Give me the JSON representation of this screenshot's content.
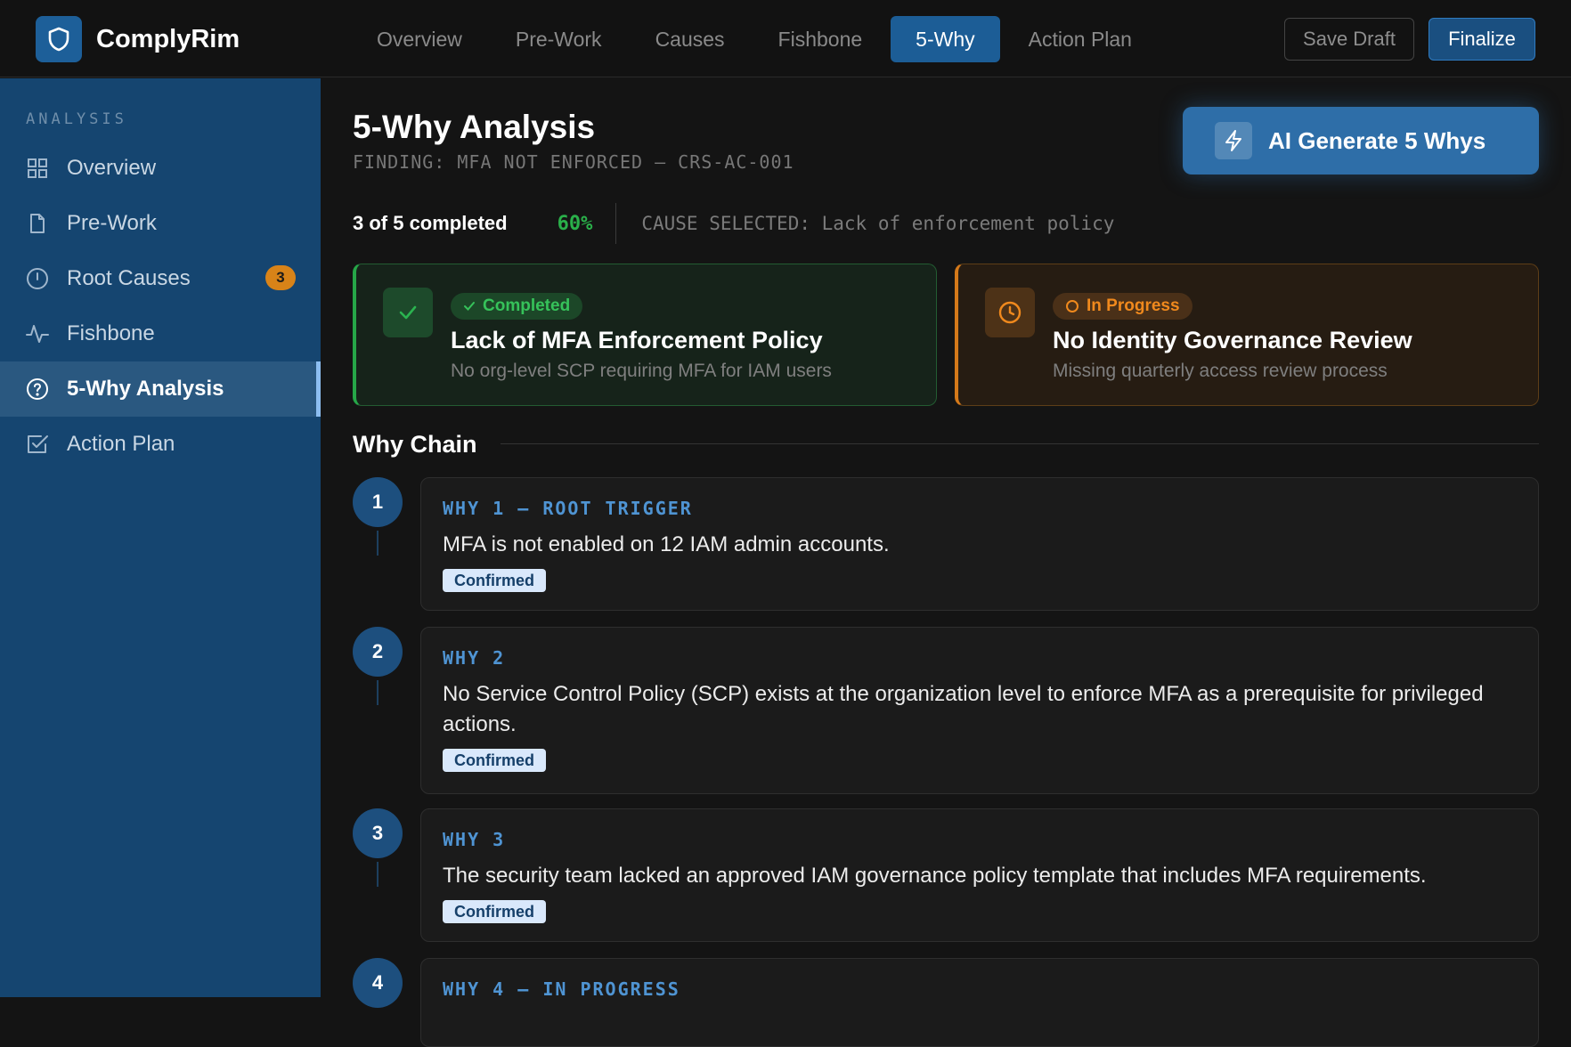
{
  "app": {
    "name": "ComplyRim"
  },
  "topnav": {
    "tabs": [
      {
        "label": "Overview"
      },
      {
        "label": "Pre-Work"
      },
      {
        "label": "Causes"
      },
      {
        "label": "Fishbone"
      },
      {
        "label": "5-Why",
        "active": true
      },
      {
        "label": "Action Plan"
      }
    ],
    "save_label": "Save Draft",
    "finalize_label": "Finalize"
  },
  "sidebar": {
    "section": "ANALYSIS",
    "items": [
      {
        "label": "Overview",
        "icon": "grid-icon"
      },
      {
        "label": "Pre-Work",
        "icon": "document-icon"
      },
      {
        "label": "Root Causes",
        "icon": "alert-circle-icon",
        "badge": "3"
      },
      {
        "label": "Fishbone",
        "icon": "pulse-icon"
      },
      {
        "label": "5-Why Analysis",
        "icon": "help-circle-icon",
        "active": true
      },
      {
        "label": "Action Plan",
        "icon": "checkbox-icon"
      }
    ]
  },
  "main": {
    "title": "5-Why Analysis",
    "finding": "FINDING: MFA NOT ENFORCED — CRS-AC-001",
    "ai_button": "AI Generate 5 Whys",
    "progress": {
      "text": "3 of 5 completed",
      "percent": "60%",
      "cause_selected": "CAUSE SELECTED: Lack of enforcement policy"
    },
    "causes": [
      {
        "status": "Completed",
        "title": "Lack of MFA Enforcement Policy",
        "desc": "No org-level SCP requiring MFA for IAM users",
        "color": "#26a748"
      },
      {
        "status": "In Progress",
        "title": "No Identity Governance Review",
        "desc": "Missing quarterly access review process",
        "color": "#d4791a"
      }
    ],
    "section_title": "Why Chain",
    "whys": [
      {
        "num": "1",
        "label": "WHY 1 — ROOT TRIGGER",
        "text": "MFA is not enabled on 12 IAM admin accounts.",
        "badge": "Confirmed"
      },
      {
        "num": "2",
        "label": "WHY 2",
        "text": "No Service Control Policy (SCP) exists at the organization level to enforce MFA as a prerequisite for privileged actions.",
        "badge": "Confirmed"
      },
      {
        "num": "3",
        "label": "WHY 3",
        "text": "The security team lacked an approved IAM governance policy template that includes MFA requirements.",
        "badge": "Confirmed"
      },
      {
        "num": "4",
        "label": "WHY 4 — IN PROGRESS"
      }
    ]
  }
}
